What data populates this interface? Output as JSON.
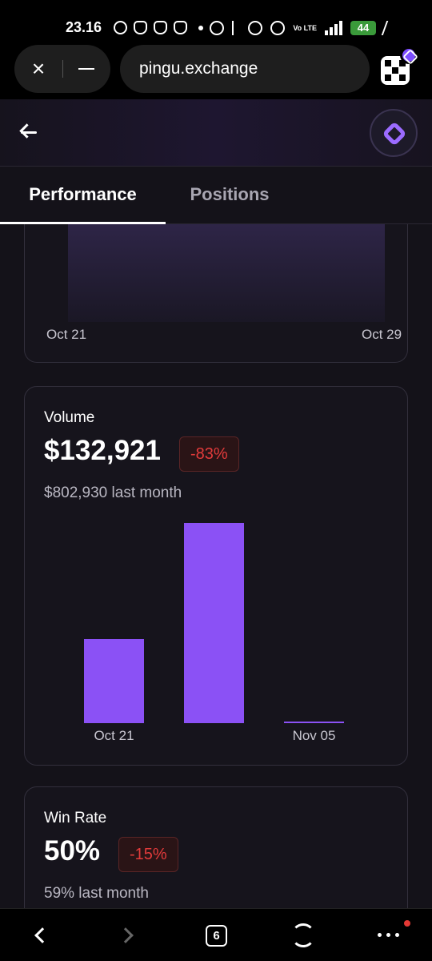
{
  "status_bar": {
    "time": "23.16",
    "battery": "44",
    "network": "Vo LTE"
  },
  "browser": {
    "url": "pingu.exchange",
    "close_glyph": "×"
  },
  "tabs": {
    "performance": "Performance",
    "positions": "Positions"
  },
  "top_chart": {
    "x_start": "Oct 21",
    "x_end": "Oct 29"
  },
  "volume": {
    "title": "Volume",
    "value": "$132,921",
    "change": "-83%",
    "last_month": "$802,930 last month"
  },
  "win_rate": {
    "title": "Win Rate",
    "value": "50%",
    "change": "-15%",
    "last_month": "59% last month"
  },
  "nav": {
    "tab_count": "6"
  },
  "colors": {
    "accent": "#8b51f5",
    "negative": "#e23b3b",
    "background": "#141219"
  },
  "chart_data": [
    {
      "type": "area",
      "x_tick_labels": [
        "Oct 21",
        "Oct 29"
      ],
      "series": []
    },
    {
      "type": "bar",
      "categories": [
        "Oct 21",
        "",
        "Nov 05"
      ],
      "values": [
        105,
        250,
        2
      ],
      "x_tick_labels": [
        "Oct 21",
        "Nov 05"
      ]
    }
  ]
}
